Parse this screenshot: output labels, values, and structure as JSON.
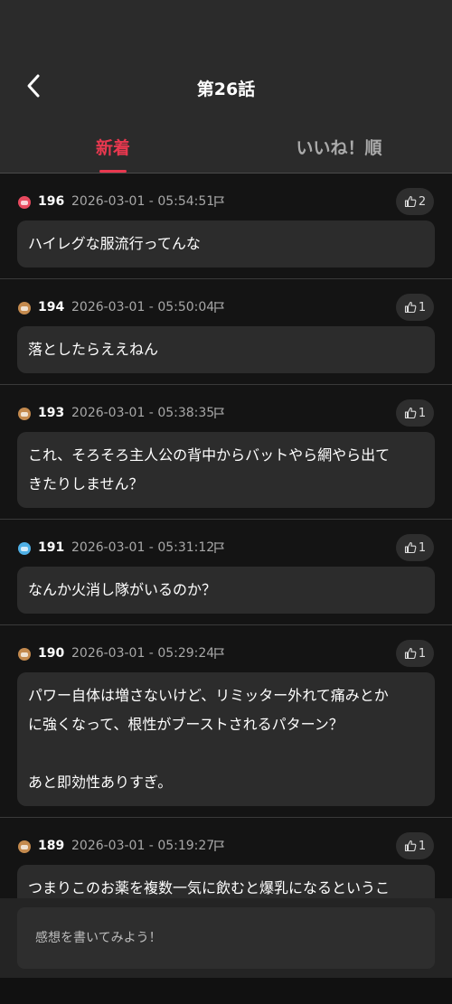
{
  "header": {
    "title": "第26話"
  },
  "tabs": [
    {
      "label": "新着",
      "active": true
    },
    {
      "label": "いいね！順",
      "active": false
    }
  ],
  "colors": {
    "accent": "#e8384f",
    "rank_red": "#e84a5f",
    "rank_bronze": "#c48a4e",
    "rank_blue": "#4fb0e6"
  },
  "comments": [
    {
      "num": "196",
      "time": "2026-03-01 - 05:54:51",
      "likes": "2",
      "badge": "red",
      "text": "ハイレグな服流行ってんな"
    },
    {
      "num": "194",
      "time": "2026-03-01 - 05:50:04",
      "likes": "1",
      "badge": "bronze",
      "text": "落としたらええねん"
    },
    {
      "num": "193",
      "time": "2026-03-01 - 05:38:35",
      "likes": "1",
      "badge": "bronze",
      "text": "これ、そろそろ主人公の背中からバットやら網やら出て\nきたりしません？"
    },
    {
      "num": "191",
      "time": "2026-03-01 - 05:31:12",
      "likes": "1",
      "badge": "blue",
      "text": "なんか火消し隊がいるのか？"
    },
    {
      "num": "190",
      "time": "2026-03-01 - 05:29:24",
      "likes": "1",
      "badge": "bronze",
      "text": "パワー自体は増さないけど、リミッター外れて痛みとか\nに強くなって、根性がブーストされるパターン？\n\nあと即効性ありすぎ。"
    },
    {
      "num": "189",
      "time": "2026-03-01 - 05:19:27",
      "likes": "1",
      "badge": "bronze",
      "text": "つまりこのお薬を複数一気に飲むと爆乳になるというこ\nとか？"
    }
  ],
  "composer": {
    "placeholder": "感想を書いてみよう！"
  },
  "icons": {
    "back": "chevron-left-icon",
    "flag": "flag-icon",
    "like": "thumbs-up-icon"
  }
}
